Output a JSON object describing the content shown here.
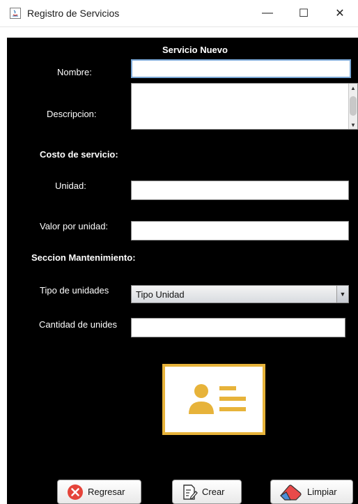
{
  "window": {
    "title": "Registro de Servicios",
    "controls": {
      "minimize": "—",
      "maximize": "☐",
      "close": "✕"
    }
  },
  "form": {
    "heading": "Servicio Nuevo",
    "nombre_label": "Nombre:",
    "nombre_value": "",
    "descripcion_label": "Descripcion:",
    "descripcion_value": "",
    "costo_heading": "Costo de servicio:",
    "unidad_label": "Unidad:",
    "unidad_value": "",
    "valor_label": "Valor por unidad:",
    "valor_value": "",
    "mantenimiento_heading": "Seccion Mantenimiento:",
    "tipo_label": "Tipo de unidades",
    "tipo_selected": "Tipo Unidad",
    "cantidad_label": "Cantidad de unides",
    "cantidad_value": ""
  },
  "logo": {
    "icon": "id-card-icon",
    "accent_color": "#e7b33a"
  },
  "buttons": {
    "regresar": "Regresar",
    "crear": "Crear",
    "limpiar": "Limpiar"
  },
  "colors": {
    "background": "#000000",
    "focus_border": "#7aa7d6",
    "close_icon_red": "#e5443a"
  }
}
